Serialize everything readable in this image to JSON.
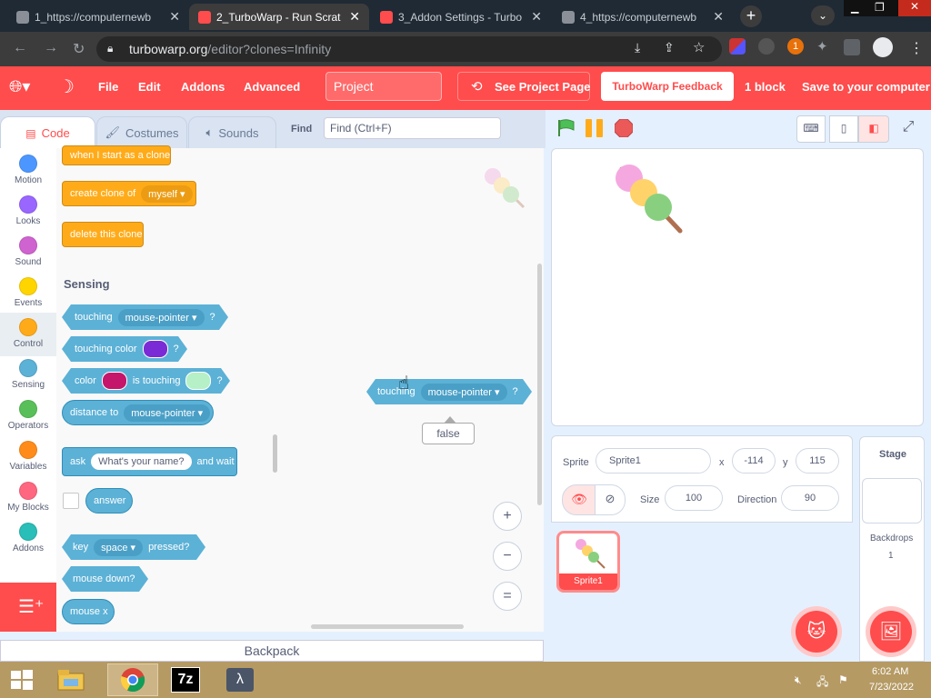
{
  "browser": {
    "tabs": [
      {
        "label": "1_https://computernewb",
        "active": false
      },
      {
        "label": "2_TurboWarp - Run Scrat",
        "active": true
      },
      {
        "label": "3_Addon Settings - Turbo",
        "active": false
      },
      {
        "label": "4_https://computernewb",
        "active": false
      }
    ],
    "url_host": "turbowarp.org",
    "url_path": "/editor?clones=Infinity",
    "new_tab": "+",
    "extension_badge": "1"
  },
  "menu": {
    "file": "File",
    "edit": "Edit",
    "addons": "Addons",
    "advanced": "Advanced",
    "project_title": "Project",
    "see_project": "See Project Page",
    "feedback": "TurboWarp Feedback",
    "block_count": "1 block",
    "save": "Save to your computer"
  },
  "editor_tabs": {
    "code": "Code",
    "costumes": "Costumes",
    "sounds": "Sounds"
  },
  "find": {
    "label": "Find",
    "placeholder": "Find (Ctrl+F)"
  },
  "categories": [
    {
      "label": "Motion",
      "color": "#4c97ff"
    },
    {
      "label": "Looks",
      "color": "#9966ff"
    },
    {
      "label": "Sound",
      "color": "#cf63cf"
    },
    {
      "label": "Events",
      "color": "#ffd500"
    },
    {
      "label": "Control",
      "color": "#ffab19"
    },
    {
      "label": "Sensing",
      "color": "#5cb1d6"
    },
    {
      "label": "Operators",
      "color": "#59c059"
    },
    {
      "label": "Variables",
      "color": "#ff8c1a"
    },
    {
      "label": "My Blocks",
      "color": "#ff6680"
    },
    {
      "label": "Addons",
      "color": "#29beb8"
    }
  ],
  "palette": {
    "when_clone": "when I start as a clone",
    "create_clone": "create clone of",
    "myself": "myself",
    "delete_clone": "delete this clone",
    "sensing_heading": "Sensing",
    "touching": "touching",
    "mouse_pointer": "mouse-pointer",
    "q": "?",
    "touching_color": "touching color",
    "color": "color",
    "is_touching": "is touching",
    "distance_to": "distance to",
    "ask": "ask",
    "whats_your_name": "What's your name?",
    "and_wait": "and wait",
    "answer": "answer",
    "key": "key",
    "space": "space",
    "pressed": "pressed?",
    "mouse_down": "mouse down?",
    "mouse_x": "mouse x"
  },
  "workspace": {
    "block_touching": "touching",
    "block_arg": "mouse-pointer",
    "block_q": "?",
    "result_bubble": "false",
    "zoom_in": "+",
    "zoom_out": "−",
    "zoom_reset": "="
  },
  "backpack": "Backpack",
  "sprite_info": {
    "sprite_label": "Sprite",
    "sprite_name": "Sprite1",
    "x_label": "x",
    "x_value": "-114",
    "y_label": "y",
    "y_value": "115",
    "size_label": "Size",
    "size_value": "100",
    "direction_label": "Direction",
    "direction_value": "90"
  },
  "sprites": [
    {
      "name": "Sprite1"
    }
  ],
  "stage_panel": {
    "title": "Stage",
    "backdrops_label": "Backdrops",
    "backdrops_count": "1"
  },
  "taskbar": {
    "time": "6:02 AM",
    "date": "7/23/2022",
    "seven_zip": "7z"
  },
  "colors": {
    "accent": "#ff4c4c",
    "sensing": "#5cb1d6",
    "control": "#ffab19"
  }
}
